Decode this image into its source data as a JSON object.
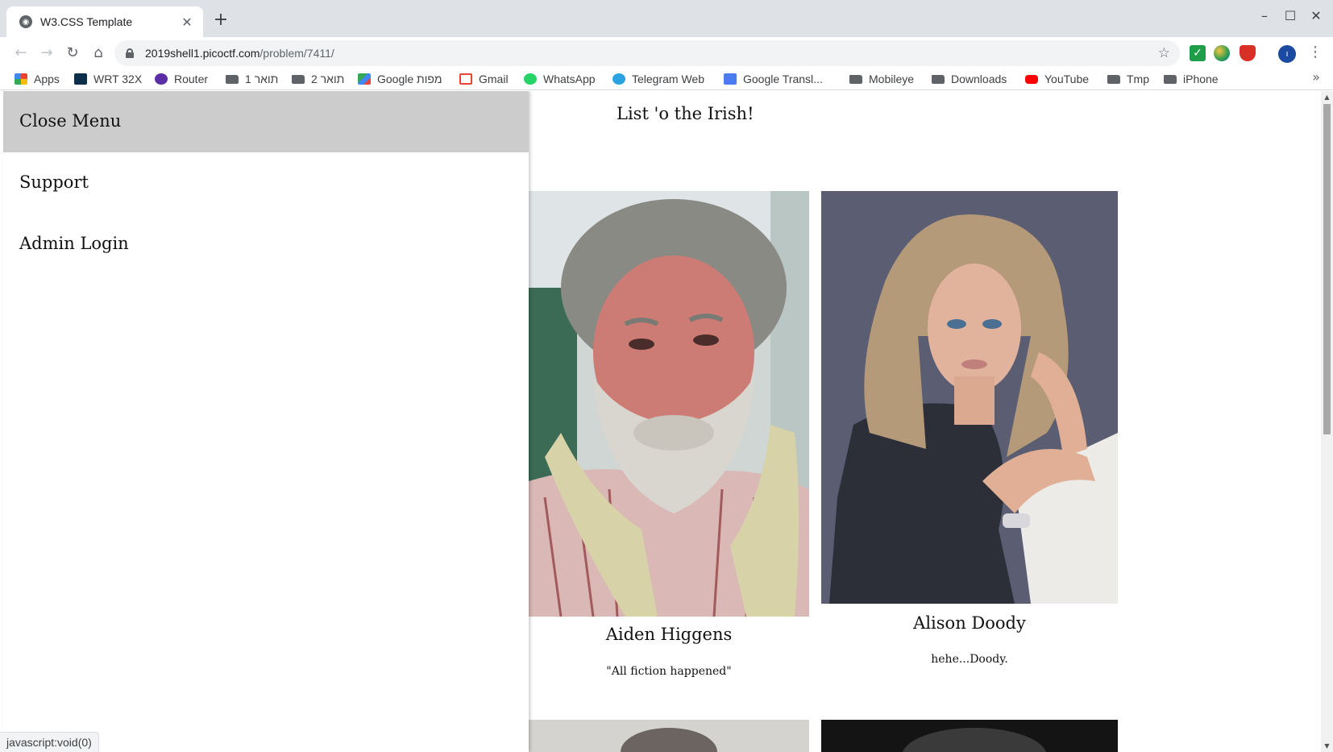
{
  "browser": {
    "tab_title": "W3.CSS Template",
    "url_host": "2019shell1.picoctf.com",
    "url_path": "/problem/7411/",
    "profile_initial": "ו",
    "bookmarks": [
      {
        "label": "Apps",
        "icon": "apps-icon"
      },
      {
        "label": "WRT 32X",
        "icon": "wifi-icon"
      },
      {
        "label": "Router",
        "icon": "router-icon"
      },
      {
        "label": "תואר 1",
        "icon": "folder-icon"
      },
      {
        "label": "תואר 2",
        "icon": "folder-icon"
      },
      {
        "label": "Google מפות",
        "icon": "maps-icon"
      },
      {
        "label": "Gmail",
        "icon": "gmail-icon"
      },
      {
        "label": "WhatsApp",
        "icon": "whatsapp-icon"
      },
      {
        "label": "Telegram Web",
        "icon": "telegram-icon"
      },
      {
        "label": "Google Transl...",
        "icon": "translate-icon"
      },
      {
        "label": "Mobileye",
        "icon": "folder-icon"
      },
      {
        "label": "Downloads",
        "icon": "folder-icon"
      },
      {
        "label": "YouTube",
        "icon": "youtube-icon"
      },
      {
        "label": "Tmp",
        "icon": "folder-icon"
      },
      {
        "label": "iPhone",
        "icon": "folder-icon"
      }
    ]
  },
  "sidebar": {
    "close_label": "Close Menu",
    "items": [
      {
        "label": "Support"
      },
      {
        "label": "Admin Login"
      }
    ]
  },
  "main": {
    "title": "List 'o the Irish!",
    "cards": [
      {
        "name": "Aiden Higgens",
        "quote": "\"All fiction happened\""
      },
      {
        "name": "Alison Doody",
        "quote": "hehe...Doody."
      }
    ]
  },
  "status": {
    "text": "javascript:void(0)"
  },
  "colors": {
    "sidebar_close_bg": "#cccccc",
    "tabbar_bg": "#dee1e6"
  }
}
